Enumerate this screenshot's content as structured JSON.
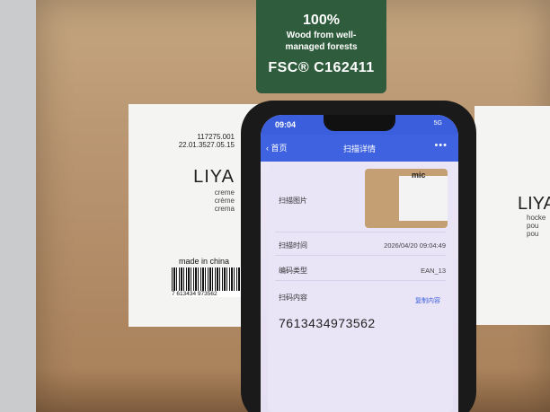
{
  "fsc_label": {
    "percent": "100%",
    "line1": "Wood from well-",
    "line2": "managed forests",
    "code": "FSC® C162411"
  },
  "left_label": {
    "code1": "117275.001",
    "code2": "22.01.3527.05.15",
    "name": "LIYA",
    "variant1": "creme",
    "variant2": "crème",
    "variant3": "crema",
    "made_in": "made in china",
    "barcode_digits": "7 613434 973562"
  },
  "right_label": {
    "name": "LIYA",
    "variant1": "hocke",
    "variant2": "pou",
    "variant3": "pou"
  },
  "phone": {
    "time": "09:04",
    "signal": "5G",
    "back_label": "首页",
    "title": "扫描详情",
    "more": "•••",
    "thumb_text": "mic",
    "rows": {
      "image_label": "扫描图片",
      "time_label": "扫描时间",
      "time_value": "2026/04/20 09:04:49",
      "type_label": "编码类型",
      "type_value": "EAN_13",
      "content_label": "扫码内容",
      "copy_label": "复制内容",
      "content_value": "7613434973562"
    }
  }
}
